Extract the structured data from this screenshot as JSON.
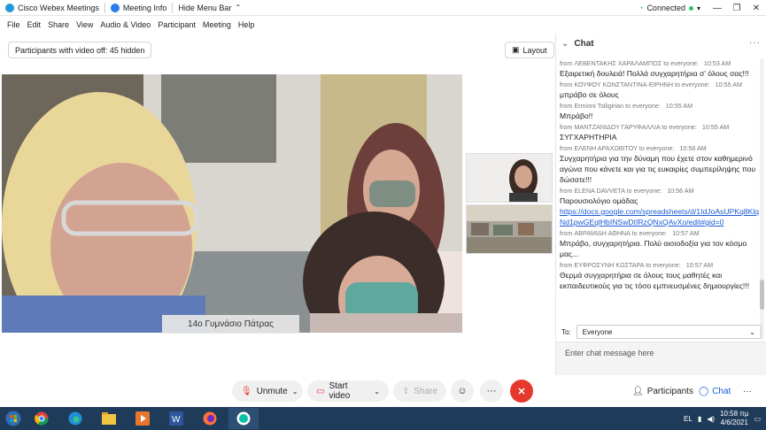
{
  "titlebar": {
    "app_name": "Cisco Webex Meetings",
    "meeting_info": "Meeting Info",
    "hide_menu": "Hide Menu Bar",
    "status": "Connected"
  },
  "menu": [
    "File",
    "Edit",
    "Share",
    "View",
    "Audio & Video",
    "Participant",
    "Meeting",
    "Help"
  ],
  "stage": {
    "participants_hidden": "Participants with video off: 45 hidden",
    "layout_label": "Layout",
    "active_speaker_name": "14ο Γυμνάσιο Πάτρας"
  },
  "chat": {
    "title": "Chat",
    "messages": [
      {
        "meta": "from ΛΕΒΕΝΤΑΚΗΣ ΧΑΡΑΛΑΜΠΟΣ to everyone:",
        "time": "10:53 AM",
        "text": "Εξαιρετική δουλειά! Πολλά συγχαρητήρια σ' όλους σας!!!"
      },
      {
        "meta": "from ΚΟΥΦΟΥ ΚΩΝΣΤΑΝΤΙΝΑ-ΕΙΡΗΝΗ to everyone:",
        "time": "10:55 AM",
        "text": "μπράβο σε όλους"
      },
      {
        "meta": "from Ermioni Tsiligirian to everyone:",
        "time": "10:55 AM",
        "text": "Μπράβο!!"
      },
      {
        "meta": "from ΜΑΝΤΖΑΝΙΔΟΥ ΓΑΡΥΦΑΛΛΙΑ to everyone:",
        "time": "10:55 AM",
        "text": "ΣΥΓΧΑΡΗΤΗΡΙΑ"
      },
      {
        "meta": "from ΕΛΕΝΗ ΑΡΑΧΩΒΙΤΟΥ to everyone:",
        "time": "10:56 AM",
        "text": "Συγχαρητήρια για την δύναμη που έχετε στον καθημερινό αγώνα που κάνετε και για τις ευκαιρίες συμπερίληψης που δώσατε!!!"
      },
      {
        "meta": "from ELENA DAVVETA to everyone:",
        "time": "10:56 AM",
        "text": "Παρουσιολόγιο ομάδας",
        "link": "https://docs.google.com/spreadsheets/d/1IdJoAsUPKq8KlqNd1pwGEqlHbINSwDtIRzQNxQAvXo/edit#gid=0"
      },
      {
        "meta": "from ΑΒΡΑΜΙΔΗ ΑΘΗΝΑ to everyone:",
        "time": "10:57 AM",
        "text": "Μπράβο, συγχαρητήρια. Πολύ αισιοδοξία για τον κόσμο μας..."
      },
      {
        "meta": "from ΕΥΦΡΟΣΥΝΗ ΚΩΣΤΑΡΑ to everyone:",
        "time": "10:57 AM",
        "text": "Θερμά συγχαρητήρια σε όλους τους μαθητές και εκπαιδευτικούς για τις τόσο εμπνευσμένες δημιουργίες!!!"
      }
    ],
    "to_label": "To:",
    "to_value": "Everyone",
    "input_placeholder": "Enter chat message here"
  },
  "controls": {
    "unmute": "Unmute",
    "start_video": "Start video",
    "share": "Share",
    "participants": "Participants",
    "chat": "Chat"
  },
  "taskbar": {
    "lang": "EL",
    "time": "10:58 πμ",
    "date": "4/6/2021"
  },
  "colors": {
    "end_call": "#e6392e",
    "taskbar": "#1f3b5a",
    "link": "#1a5cd7",
    "connected": "#2ec26b"
  }
}
